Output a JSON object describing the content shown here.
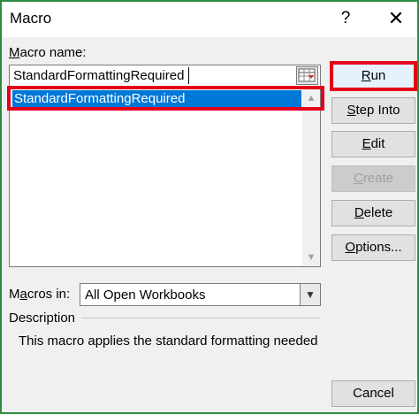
{
  "window": {
    "title": "Macro",
    "help_label": "?",
    "close_label": "✕"
  },
  "macro_name": {
    "label_prefix": "M",
    "label_rest": "acro name:",
    "value": "StandardFormattingRequired"
  },
  "macro_list": {
    "items": [
      "StandardFormattingRequired"
    ],
    "selected_index": 0
  },
  "buttons": {
    "run": {
      "mnemonic": "R",
      "rest": "un"
    },
    "step_into": {
      "mnemonic": "S",
      "rest": "tep Into"
    },
    "edit": {
      "mnemonic": "E",
      "rest": "dit"
    },
    "create": {
      "mnemonic": "C",
      "rest": "reate"
    },
    "delete": {
      "mnemonic": "D",
      "rest": "elete"
    },
    "options": {
      "mnemonic": "O",
      "rest": "ptions..."
    },
    "cancel": "Cancel"
  },
  "macros_in": {
    "label_prefix": "M",
    "label_mnemonic": "a",
    "label_rest": "cros in:",
    "value": "All Open Workbooks"
  },
  "description": {
    "label": "Description",
    "text": "This macro applies the standard formatting needed"
  },
  "colors": {
    "selection": "#0078d7",
    "highlight_box": "#e3001b",
    "frame": "#2e8b3e"
  }
}
